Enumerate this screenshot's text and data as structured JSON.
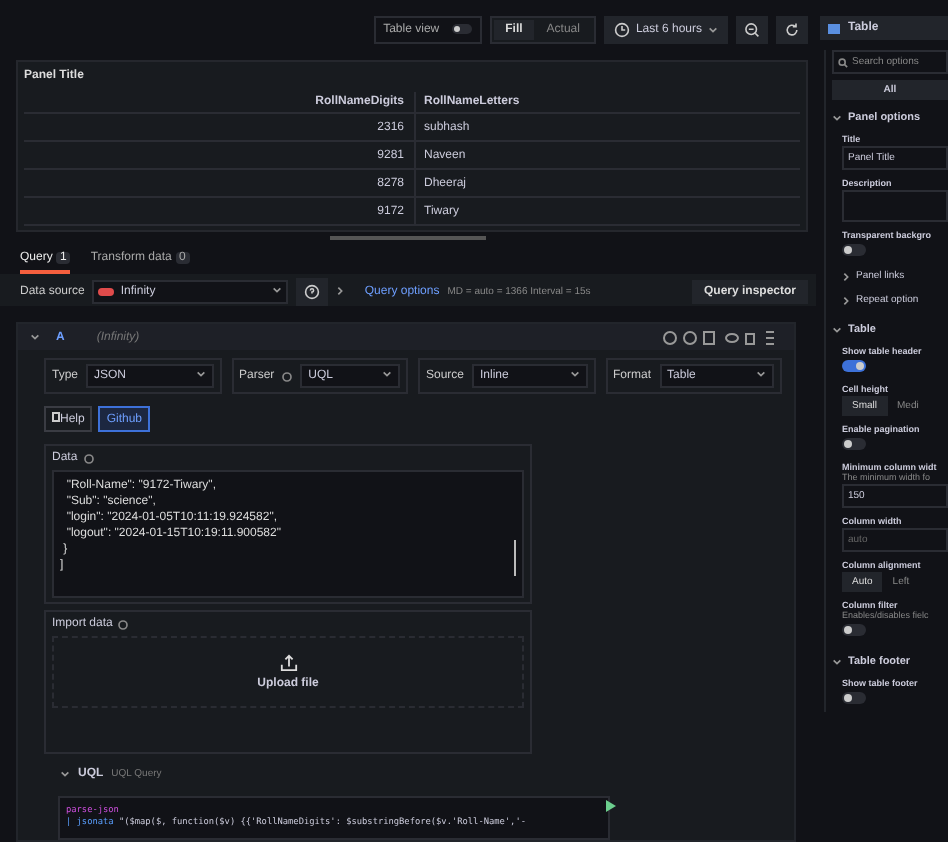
{
  "toolbar": {
    "table_view": {
      "label": "Table view",
      "on": false
    },
    "fill_options": [
      {
        "label": "Fill",
        "selected": true
      },
      {
        "label": "Actual",
        "selected": false
      }
    ],
    "time_range": "Last 6 hours",
    "visualization": "Table"
  },
  "panel": {
    "title": "Panel Title",
    "columns": [
      "RollNameDigits",
      "RollNameLetters"
    ],
    "rows": [
      [
        "2316",
        "subhash"
      ],
      [
        "9281",
        "Naveen"
      ],
      [
        "8278",
        "Dheeraj"
      ],
      [
        "9172",
        "Tiwary"
      ]
    ]
  },
  "tabs": [
    {
      "label": "Query",
      "count": "1",
      "selected": true
    },
    {
      "label": "Transform data",
      "count": "0",
      "selected": false
    }
  ],
  "data_source": {
    "label": "Data source",
    "value": "Infinity",
    "query_options": "Query options",
    "query_meta": "MD = auto = 1366   Interval = 15s",
    "inspector": "Query inspector"
  },
  "query": {
    "ref": "A",
    "source_name": "(Infinity)",
    "expanded": true,
    "fields": [
      {
        "label": "Type",
        "value": "JSON",
        "info": false
      },
      {
        "label": "Parser",
        "value": "UQL",
        "info": true
      },
      {
        "label": "Source",
        "value": "Inline",
        "info": false
      },
      {
        "label": "Format",
        "value": "Table",
        "info": false
      }
    ],
    "links": [
      "Help",
      "Github"
    ],
    "data_label": "Data",
    "data_lines": [
      "  \"Roll-Name\": \"9172-Tiwary\",",
      "  \"Sub\": \"science\",",
      "  \"login\": \"2024-01-05T10:11:19.924582\",",
      "  \"logout\": \"2024-01-15T10:19:11.900582\"",
      " }",
      "]"
    ],
    "import_label": "Import data",
    "upload": "Upload file",
    "uql_title": "UQL",
    "uql_sub": "UQL Query",
    "uql_lines": [
      {
        "keyword": "parse-json"
      },
      {
        "keyword": "| jsonata",
        "rest": " \"($map($, function($v) {{'RollNameDigits': $substringBefore($v.'Roll-Name','-"
      }
    ]
  },
  "options": {
    "search": "Search options",
    "all": "All",
    "sections": [
      {
        "title": "Panel options",
        "items": [
          {
            "kind": "input",
            "label": "Title",
            "value": "Panel Title"
          },
          {
            "kind": "textarea",
            "label": "Description"
          },
          {
            "kind": "toggle",
            "label": "Transparent backgro",
            "on": false
          },
          {
            "kind": "sub",
            "label": "Panel links"
          },
          {
            "kind": "sub",
            "label": "Repeat option"
          }
        ]
      },
      {
        "title": "Table",
        "items": [
          {
            "kind": "toggle",
            "label": "Show table header",
            "on": true
          },
          {
            "kind": "segments",
            "label": "Cell height",
            "segments": [
              {
                "label": "Small",
                "selected": true
              },
              {
                "label": "Medi",
                "selected": false
              }
            ]
          },
          {
            "kind": "toggle",
            "label": "Enable pagination",
            "on": false
          },
          {
            "kind": "input",
            "label": "Minimum column widt",
            "description": "The minimum width fo",
            "value": "150"
          },
          {
            "kind": "input",
            "label": "Column width",
            "placeholder": "auto"
          },
          {
            "kind": "segments",
            "label": "Column alignment",
            "segments": [
              {
                "label": "Auto",
                "selected": true
              },
              {
                "label": "Left",
                "selected": false
              }
            ]
          },
          {
            "kind": "toggle",
            "label": "Column filter",
            "description": "Enables/disables fielc",
            "on": false
          }
        ]
      },
      {
        "title": "Table footer",
        "items": [
          {
            "kind": "toggle",
            "label": "Show table footer",
            "on": false
          }
        ]
      }
    ]
  }
}
